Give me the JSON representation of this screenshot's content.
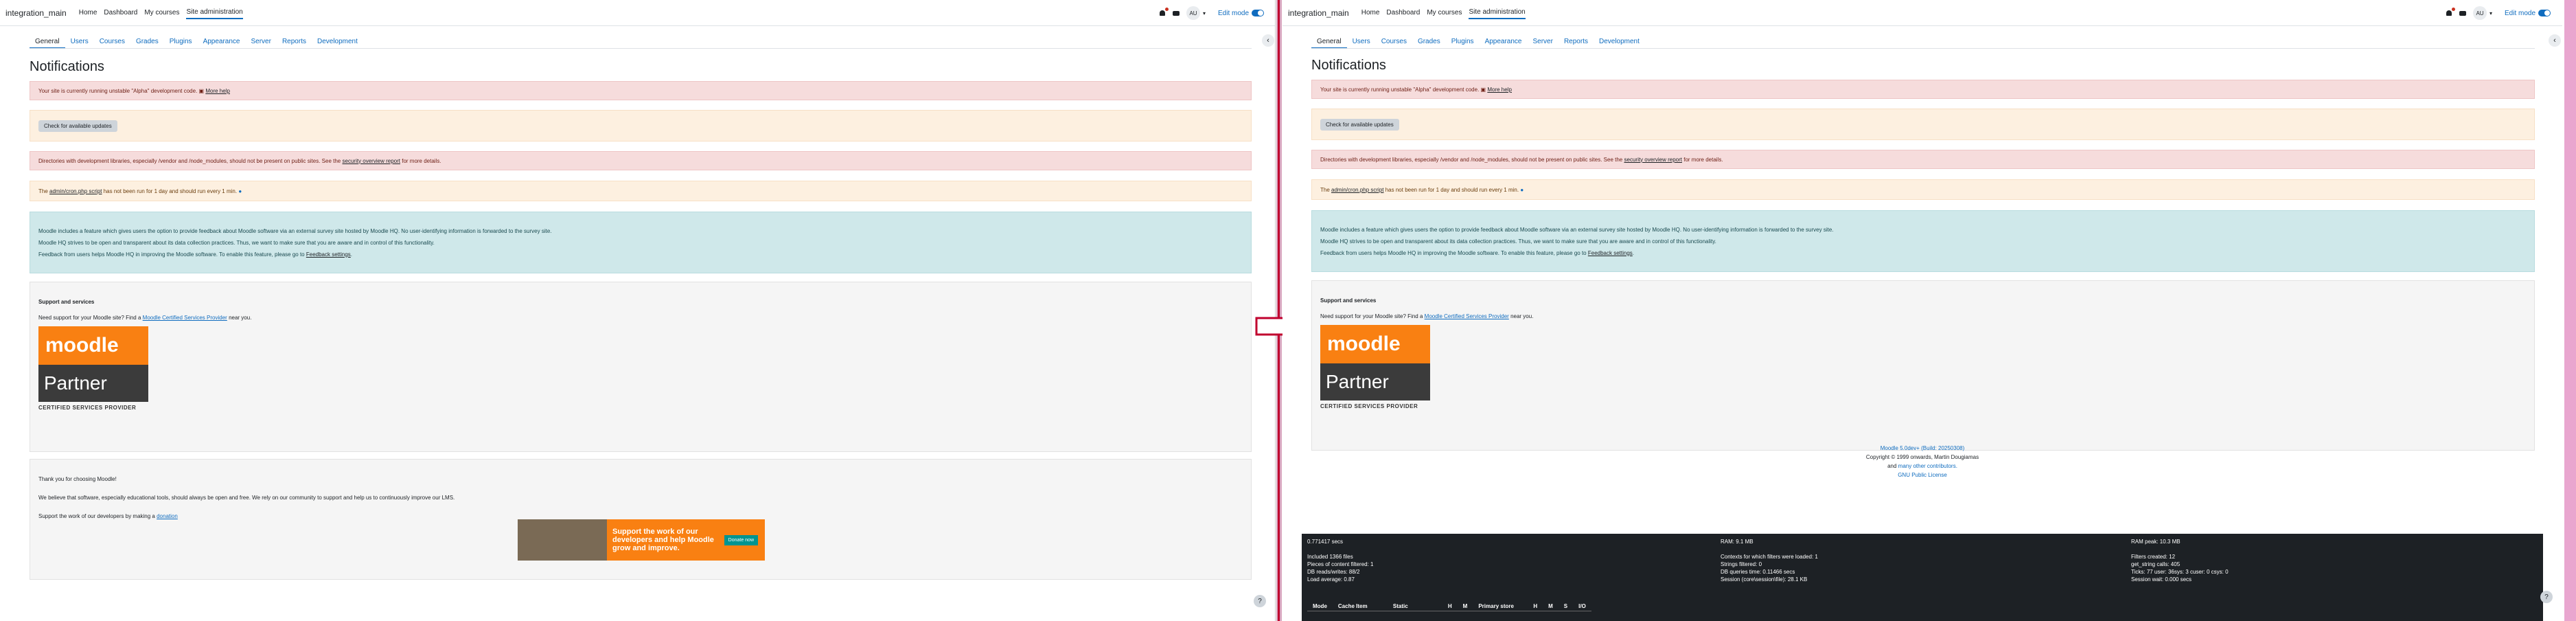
{
  "site_name": "integration_main",
  "nav": [
    "Home",
    "Dashboard",
    "My courses",
    "Site administration"
  ],
  "user_initials": "AU",
  "edit_mode": "Edit mode",
  "tabs": [
    "General",
    "Users",
    "Courses",
    "Grades",
    "Plugins",
    "Appearance",
    "Server",
    "Reports",
    "Development"
  ],
  "page_title": "Notifications",
  "alerts": {
    "alpha": {
      "text": "Your site is currently running unstable \"Alpha\" development code.",
      "link": "More help"
    },
    "check_button": "Check for available updates",
    "devlibs": {
      "pre": "Directories with development libraries, especially /vendor and /node_modules, should not be present on public sites. See the",
      "link": "security overview report",
      "post": "for more details."
    },
    "cron": {
      "link": "admin/cron.php script",
      "text": "has not been run for 1 day and should run every 1 min."
    },
    "feedback": {
      "p1": "Moodle includes a feature which gives users the option to provide feedback about Moodle software via an external survey site hosted by Moodle HQ. No user-identifying information is forwarded to the survey site.",
      "p2": "Moodle HQ strives to be open and transparent about its data collection practices. Thus, we want to make sure that you are aware and in control of this functionality.",
      "p3_pre": "Feedback from users helps Moodle HQ in improving the Moodle software. To enable this feature, please go to",
      "p3_link": "Feedback settings",
      "p3_post": "."
    }
  },
  "support": {
    "heading": "Support and services",
    "pre": "Need support for your Moodle site? Find a",
    "link": "Moodle Certified Services Provider",
    "post": "near you.",
    "logo_top": "moodle",
    "logo_bottom": "Partner",
    "certified": "CERTIFIED SERVICES PROVIDER"
  },
  "thanks": {
    "p1": "Thank you for choosing Moodle!",
    "p2": "We believe that software, especially educational tools, should always be open and free. We rely on our community to support and help us to continuously improve our LMS.",
    "p3_pre": "Support the work of our developers by making a",
    "p3_link": "donation",
    "banner_text": "Support the work of our developers and help Moodle grow and improve.",
    "banner_cta": "Donate now"
  },
  "footer": {
    "version": "Moodle 5.0dev+ (Build: 20250308)",
    "copyright": "Copyright © 1999 onwards, Martin Dougiamas",
    "contributors_pre": "and",
    "contributors_link": "many other contributors.",
    "license": "GNU Public License"
  },
  "perf": {
    "c1": [
      "0.771417 secs",
      "",
      "Included 1366 files",
      "Pieces of content filtered: 1",
      "DB reads/writes: 88/2",
      "Load average: 0.87"
    ],
    "c2": [
      "RAM: 9.1 MB",
      "",
      "Contexts for which filters were loaded: 1",
      "Strings filtered: 0",
      "DB queries time: 0.11466 secs",
      "Session (core\\session\\file): 28.1 KB"
    ],
    "c3": [
      "RAM peak: 10.3 MB",
      "",
      "Filters created: 12",
      "get_string calls: 405",
      "Ticks: 77 user: 36sys: 3 cuser: 0 csys: 0",
      "Session wait: 0.000 secs"
    ],
    "table_headers": [
      "Mode",
      "Cache Item",
      "Static",
      "H",
      "M",
      "Primary store",
      "H",
      "M",
      "S",
      "I/O"
    ]
  },
  "colors": {
    "accent": "#0f6cbf",
    "arrow": "#c0002e"
  }
}
